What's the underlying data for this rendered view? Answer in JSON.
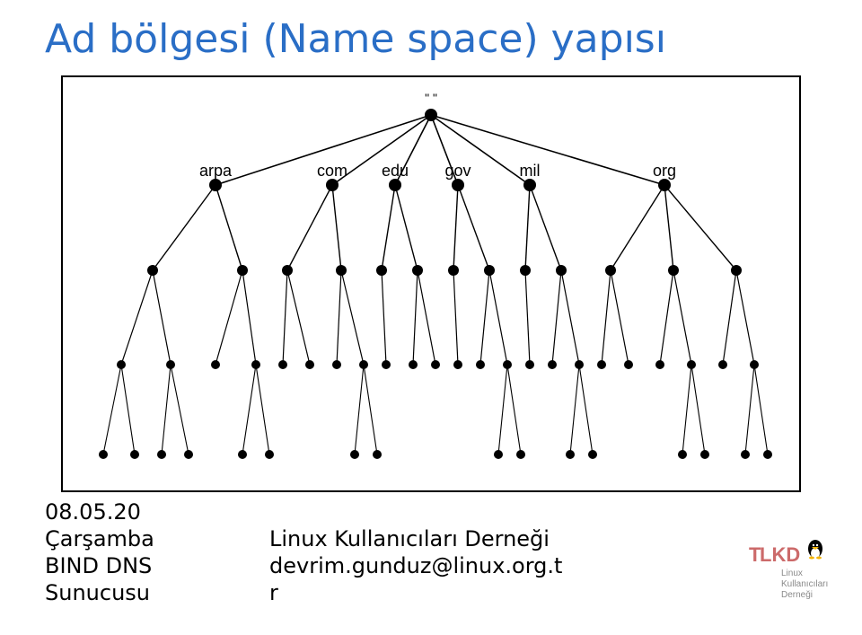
{
  "title": "Ad bölgesi (Name space) yapısı",
  "root_label": "\" \"",
  "tlds": [
    "arpa",
    "com",
    "edu",
    "gov",
    "mil",
    "org"
  ],
  "footer_left": {
    "line1": "08.05.20",
    "line2": "Çarşamba",
    "line3": "BIND DNS",
    "line4": "Sunucusu"
  },
  "footer_mid": {
    "line1": "Linux Kullanıcıları Derneği",
    "line2": "devrim.gunduz@linux.org.t",
    "line3": "r"
  },
  "logo": {
    "line1": "Linux",
    "line2": "Kullanıcıları",
    "line3": "Derneği",
    "big_prefix": "T",
    "big_rest": "LKD"
  }
}
